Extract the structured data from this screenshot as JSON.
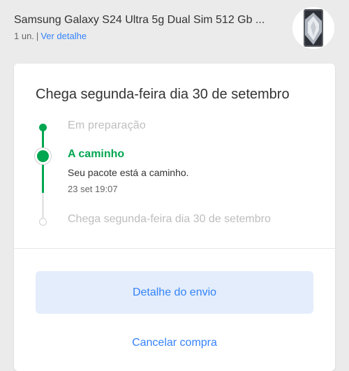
{
  "product": {
    "title": "Samsung Galaxy S24 Ultra 5g Dual Sim 512 Gb ...",
    "quantity": "1 un.",
    "separator": "|",
    "details_link": "Ver detalhe",
    "image_icon": "smartphone-image"
  },
  "shipment": {
    "title": "Chega segunda-feira dia 30 de setembro",
    "steps": [
      {
        "label": "Em preparação",
        "state": "done"
      },
      {
        "label": "A caminho",
        "state": "current",
        "description": "Seu pacote está a caminho.",
        "time": "23 set 19:07"
      },
      {
        "label": "Chega segunda-feira dia 30 de setembro",
        "state": "pending"
      }
    ],
    "primary_button": "Detalhe do envio",
    "secondary_button": "Cancelar compra"
  },
  "colors": {
    "accent": "#3483fa",
    "success": "#00a650",
    "muted": "#bdbdbd",
    "background": "#ebebeb"
  }
}
